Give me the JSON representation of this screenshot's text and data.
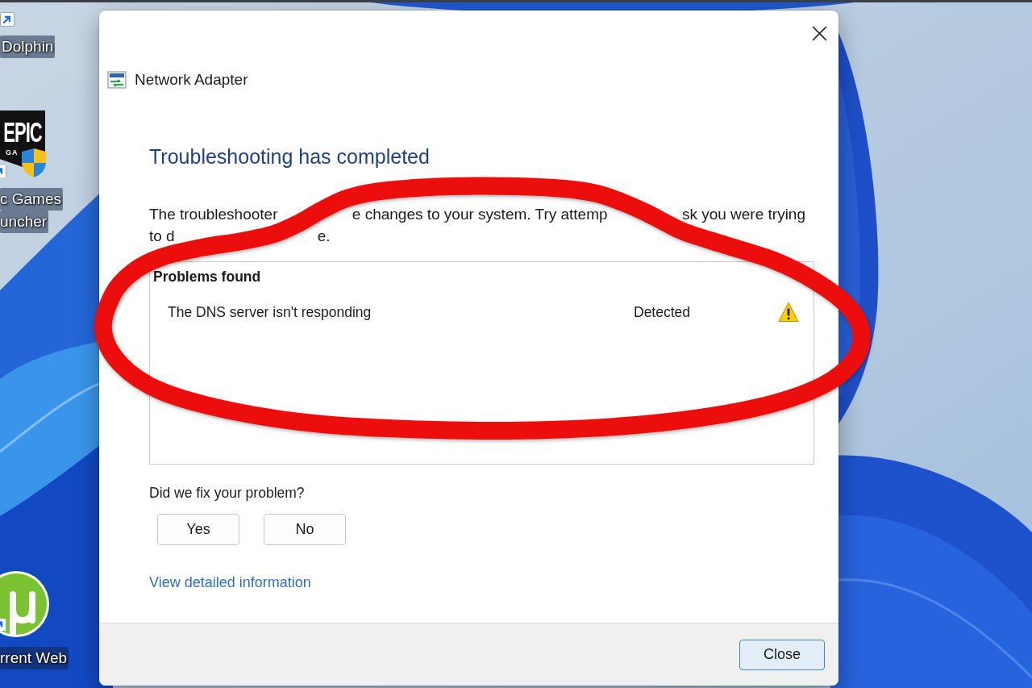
{
  "desktop": {
    "icons": [
      {
        "kind": "shortcut",
        "label_lines": [
          "Dolphin"
        ]
      },
      {
        "kind": "tile",
        "logo_text": [
          "EPIC",
          "GA"
        ],
        "label_lines": [
          "c Games",
          "uncher"
        ]
      },
      {
        "kind": "disc",
        "label_lines": [
          "rrent Web"
        ]
      }
    ]
  },
  "dialog": {
    "title": "Network Adapter",
    "heading": "Troubleshooting has completed",
    "description_lines": [
      [
        "The troubleshooter",
        "e changes to your system. Try attemp",
        "sk you were trying"
      ],
      [
        "to d",
        "e."
      ]
    ],
    "problems": {
      "title": "Problems found",
      "rows": [
        {
          "problem": "The DNS server isn't responding",
          "status": "Detected",
          "kind": "warning"
        }
      ]
    },
    "question": "Did we fix your problem?",
    "answer_buttons": [
      "Yes",
      "No"
    ],
    "link": "View detailed information",
    "footer_buttons": [
      {
        "label": "Close",
        "default": true
      }
    ]
  },
  "annotation": {
    "kind": "ellipse"
  }
}
